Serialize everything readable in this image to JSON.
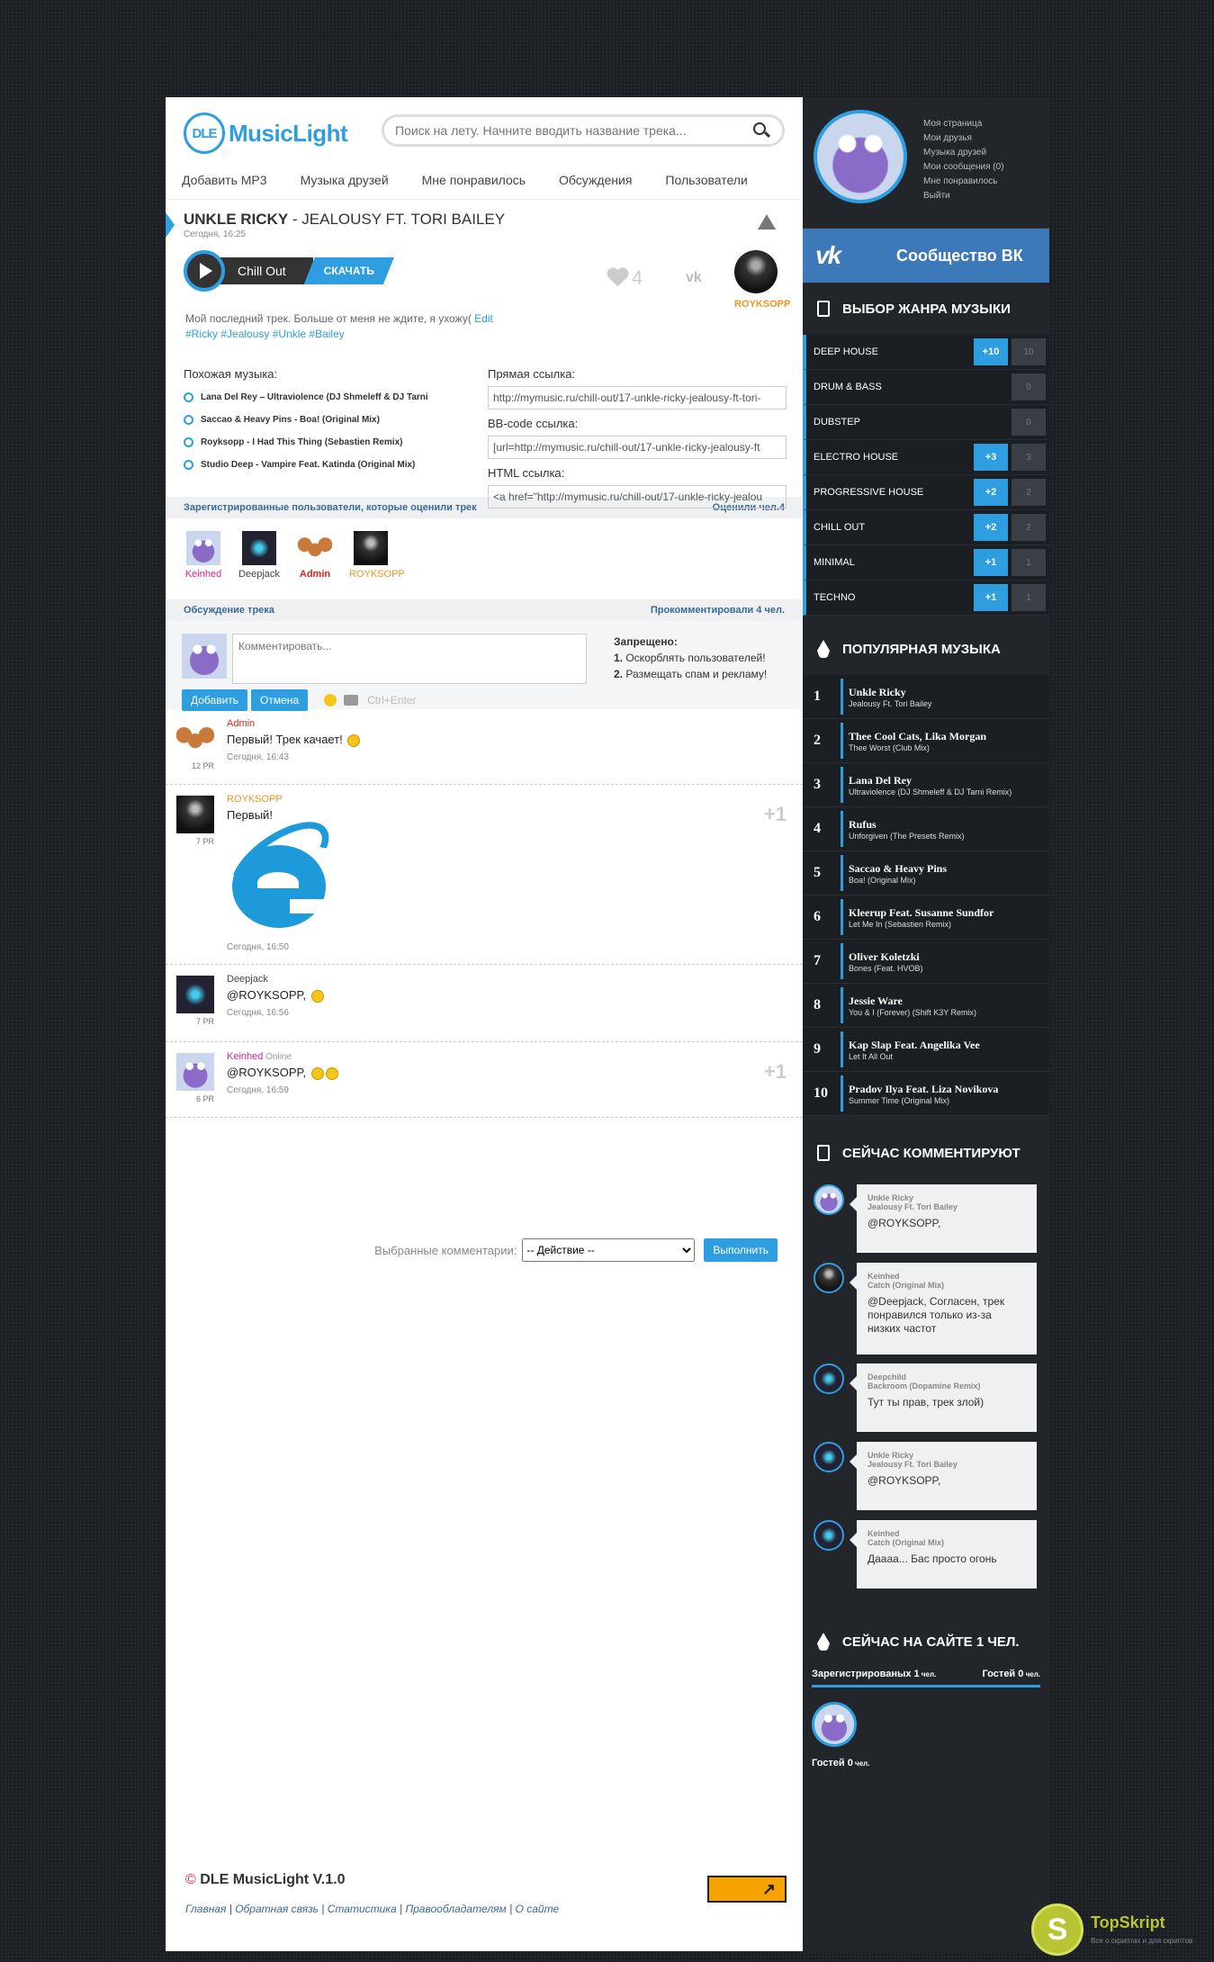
{
  "header": {
    "logo_badge": "DLE",
    "logo_text": "MusicLight",
    "search_placeholder": "Поиск на лету. Начните вводить название трека..."
  },
  "nav": [
    "Добавить MP3",
    "Музыка друзей",
    "Мне понравилось",
    "Обсуждения",
    "Пользователи"
  ],
  "track": {
    "artist": "UNKLE RICKY",
    "title": " - JEALOUSY FT. TORI BAILEY",
    "date": "Сегодня, 16:25",
    "genre": "Chill Out",
    "download": "СКАЧАТЬ",
    "likes": "4",
    "vk": "vk",
    "uploader": "ROYKSOPP",
    "description": "Мой последний трек. Больше от меня не ждите, я ухожу(",
    "edit": " Edit",
    "tags": "#Ricky #Jealousy #Unkle #Bailey",
    "similar_title": "Похожая музыка:",
    "similar": [
      "Lana Del Rey – Ultraviolence (DJ Shmeleff & DJ Tarni",
      "Saccao & Heavy Pins - Boa! (Original Mix)",
      "Royksopp - I Had This Thing (Sebastien Remix)",
      "Studio Deep - Vampire Feat. Katinda (Original Mix)"
    ],
    "direct_label": "Прямая ссылка:",
    "direct_value": "http://mymusic.ru/chill-out/17-unkle-ricky-jealousy-ft-tori-",
    "bb_label": "BB-code ссылка:",
    "bb_value": "[url=http://mymusic.ru/chill-out/17-unkle-ricky-jealousy-ft",
    "html_label": "HTML ссылка:",
    "html_value": "<a href=\"http://mymusic.ru/chill-out/17-unkle-ricky-jealou"
  },
  "raters_section": {
    "title": "Зарегистрированные пользователи, которые оценили трек",
    "count": "Оценили чел.4"
  },
  "raters": [
    {
      "name": "Keinhed",
      "color": "#e0208a"
    },
    {
      "name": "Deepjack",
      "color": "#444444"
    },
    {
      "name": "Admin",
      "color": "#e02020"
    },
    {
      "name": "ROYKSOPP",
      "color": "#f7931e"
    }
  ],
  "discussion": {
    "title": "Обсуждение трека",
    "count": "Прокомментировали 4 чел."
  },
  "form": {
    "placeholder": "Комментировать...",
    "rules_title": "Запрещено:",
    "rule1_n": "1.",
    "rule1": " Оскорблять пользователей!",
    "rule2_n": "2.",
    "rule2": " Размещать спам и рекламу!",
    "add": "Добавить",
    "cancel": "Отмена",
    "hint": "Ctrl+Enter"
  },
  "comments": [
    {
      "author": "Admin",
      "color": "#e02020",
      "rep": "12 PR",
      "text": "Первый! Трек качает!",
      "time": "Сегодня, 16:43"
    },
    {
      "author": "ROYKSOPP",
      "color": "#f7931e",
      "rep": "7 PR",
      "text": "Первый!",
      "time": "Сегодня, 16:50",
      "plus": "+1"
    },
    {
      "author": "Deepjack",
      "color": "#444444",
      "rep": "7 PR",
      "text": "@ROYKSOPP,",
      "time": "Сегодня, 16:56"
    },
    {
      "author": "Keinhed",
      "color": "#e0208a",
      "status": " Online",
      "rep": "6 PR",
      "text": "@ROYKSOPP,",
      "time": "Сегодня, 16:59",
      "plus": "+1"
    }
  ],
  "bulk": {
    "label": "Выбранные комментарии:",
    "select": "-- Действие --",
    "run": "Выполнить"
  },
  "footer": {
    "copy": "©",
    "name": " DLE MusicLight V.1.0",
    "links": [
      "Главная",
      "Обратная связь",
      "Статистика",
      "Правообладателям",
      "О сайте"
    ],
    "sep": " | ",
    "arrow": "↗"
  },
  "side": {
    "user_menu": [
      "Моя страница",
      "Мои друзья",
      "Музыка друзей",
      "Мои сообщения (0)",
      "Мне понравилось",
      "Выйти"
    ],
    "vk_logo": "vk",
    "vk_label": "Сообщество ВК",
    "genres_title": "Выбор жанра музыки",
    "genres": [
      {
        "name": "DEEP HOUSE",
        "plus": "+10",
        "count": "10"
      },
      {
        "name": "DRUM & BASS",
        "plus": "",
        "count": "0"
      },
      {
        "name": "DUBSTEP",
        "plus": "",
        "count": "0"
      },
      {
        "name": "ELECTRO HOUSE",
        "plus": "+3",
        "count": "3"
      },
      {
        "name": "PROGRESSIVE HOUSE",
        "plus": "+2",
        "count": "2"
      },
      {
        "name": "CHILL OUT",
        "plus": "+2",
        "count": "2"
      },
      {
        "name": "MINIMAL",
        "plus": "+1",
        "count": "1"
      },
      {
        "name": "TECHNO",
        "plus": "+1",
        "count": "1"
      }
    ],
    "popular_title": "Популярная музыка",
    "popular": [
      {
        "n": "1",
        "artist": "Unkle Ricky",
        "title": "Jealousy Ft. Tori Bailey"
      },
      {
        "n": "2",
        "artist": "Thee Cool Cats, Lika Morgan",
        "title": "Thee Worst (Club Mix)"
      },
      {
        "n": "3",
        "artist": "Lana Del Rey",
        "title": "Ultraviolence (DJ Shmeleff & DJ Tarni Remix)"
      },
      {
        "n": "4",
        "artist": "Rufus",
        "title": "Unforgiven (The Presets Remix)"
      },
      {
        "n": "5",
        "artist": "Saccao & Heavy Pins",
        "title": "Boa! (Original Mix)"
      },
      {
        "n": "6",
        "artist": "Kleerup Feat. Susanne Sundfor",
        "title": "Let Me In (Sebastien Remix)"
      },
      {
        "n": "7",
        "artist": "Oliver Koletzki",
        "title": "Bones (Feat. HVOB)"
      },
      {
        "n": "8",
        "artist": "Jessie Ware",
        "title": "You & I (Forever) (Shift K3Y Remix)"
      },
      {
        "n": "9",
        "artist": "Kap Slap Feat. Angelika Vee",
        "title": "Let It All Out"
      },
      {
        "n": "10",
        "artist": "Pradov Ilya Feat. Liza Novikova",
        "title": "Summer Time (Original Mix)"
      }
    ],
    "latest_title": "Сейчас комментируют",
    "latest": [
      {
        "l1": "Unkle Ricky",
        "l2": "Jealousy Ft. Tori Bailey",
        "text": "@ROYKSOPP,"
      },
      {
        "l1": "Keinhed",
        "l2": "Catch (Original Mix)",
        "text": "@Deepjack, Согласен, трек понравился только из-за низких частот"
      },
      {
        "l1": "Deepchild",
        "l2": "Backroom (Dopamine Remix)",
        "text": "Тут ты прав, трек злой)"
      },
      {
        "l1": "Unkle Ricky",
        "l2": "Jealousy Ft. Tori Bailey",
        "text": "@ROYKSOPP,"
      },
      {
        "l1": "Keinhed",
        "l2": "Catch (Original Mix)",
        "text": "Даааа... Бас просто огонь"
      }
    ],
    "online_title": "Сейчас на сайте 1 чел.",
    "online_reg": "Зарегистрированых 1",
    "online_reg_unit": " чел.",
    "online_guests": "Гостей 0",
    "online_guests_unit": " чел.",
    "online_foot": "Гостей 0",
    "online_foot_unit": " чел."
  },
  "watermark": {
    "letter": "S",
    "name": "TopSkript",
    "tagline": "Все о скриптах и для скриптов"
  }
}
